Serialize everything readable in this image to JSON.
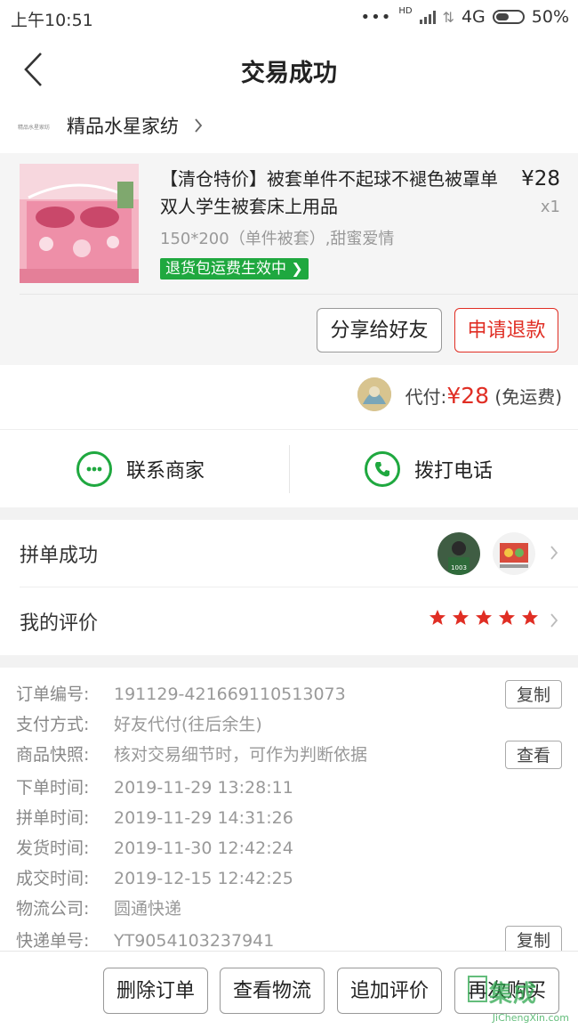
{
  "status_bar": {
    "time": "上午10:51",
    "net": "4G",
    "hd": "HD",
    "battery": "50%"
  },
  "header": {
    "title": "交易成功"
  },
  "shop": {
    "logo_text": "精品水星家纺",
    "name": "精品水星家纺"
  },
  "product": {
    "title": "【清仓特价】被套单件不起球不褪色被罩单双人学生被套床上用品",
    "price": "¥28",
    "qty": "x1",
    "spec": "150*200（单件被套）,甜蜜爱情",
    "badge": "退货包运费生效中",
    "share_button": "分享给好友",
    "refund_button": "申请退款"
  },
  "payment": {
    "label": "代付:",
    "amount": "¥28",
    "note": "(免运费)"
  },
  "contact": {
    "merchant": "联系商家",
    "call": "拨打电话"
  },
  "group": {
    "label": "拼单成功"
  },
  "review": {
    "label": "我的评价",
    "rating": 5
  },
  "details": {
    "order_no": {
      "k": "订单编号:",
      "v": "191129-421669110513073",
      "btn": "复制"
    },
    "pay_method": {
      "k": "支付方式:",
      "v": "好友代付(往后余生)"
    },
    "snapshot": {
      "k": "商品快照:",
      "v": "核对交易细节时，可作为判断依据",
      "btn": "查看"
    },
    "order_time": {
      "k": "下单时间:",
      "v": "2019-11-29 13:28:11"
    },
    "group_time": {
      "k": "拼单时间:",
      "v": "2019-11-29 14:31:26"
    },
    "ship_time": {
      "k": "发货时间:",
      "v": "2019-11-30 12:42:24"
    },
    "deal_time": {
      "k": "成交时间:",
      "v": "2019-12-15 12:42:25"
    },
    "carrier": {
      "k": "物流公司:",
      "v": "圆通快递"
    },
    "tracking": {
      "k": "快递单号:",
      "v": "YT9054103237941",
      "btn": "复制"
    }
  },
  "bottom": {
    "delete": "删除订单",
    "logistics": "查看物流",
    "add_review": "追加评价",
    "buy_again": "再次购买"
  },
  "watermark": {
    "main": "集成",
    "sub": "JiChengXin.com"
  },
  "colors": {
    "accent": "#e02e24",
    "green": "#1fa83f",
    "star": "#e02e24"
  }
}
